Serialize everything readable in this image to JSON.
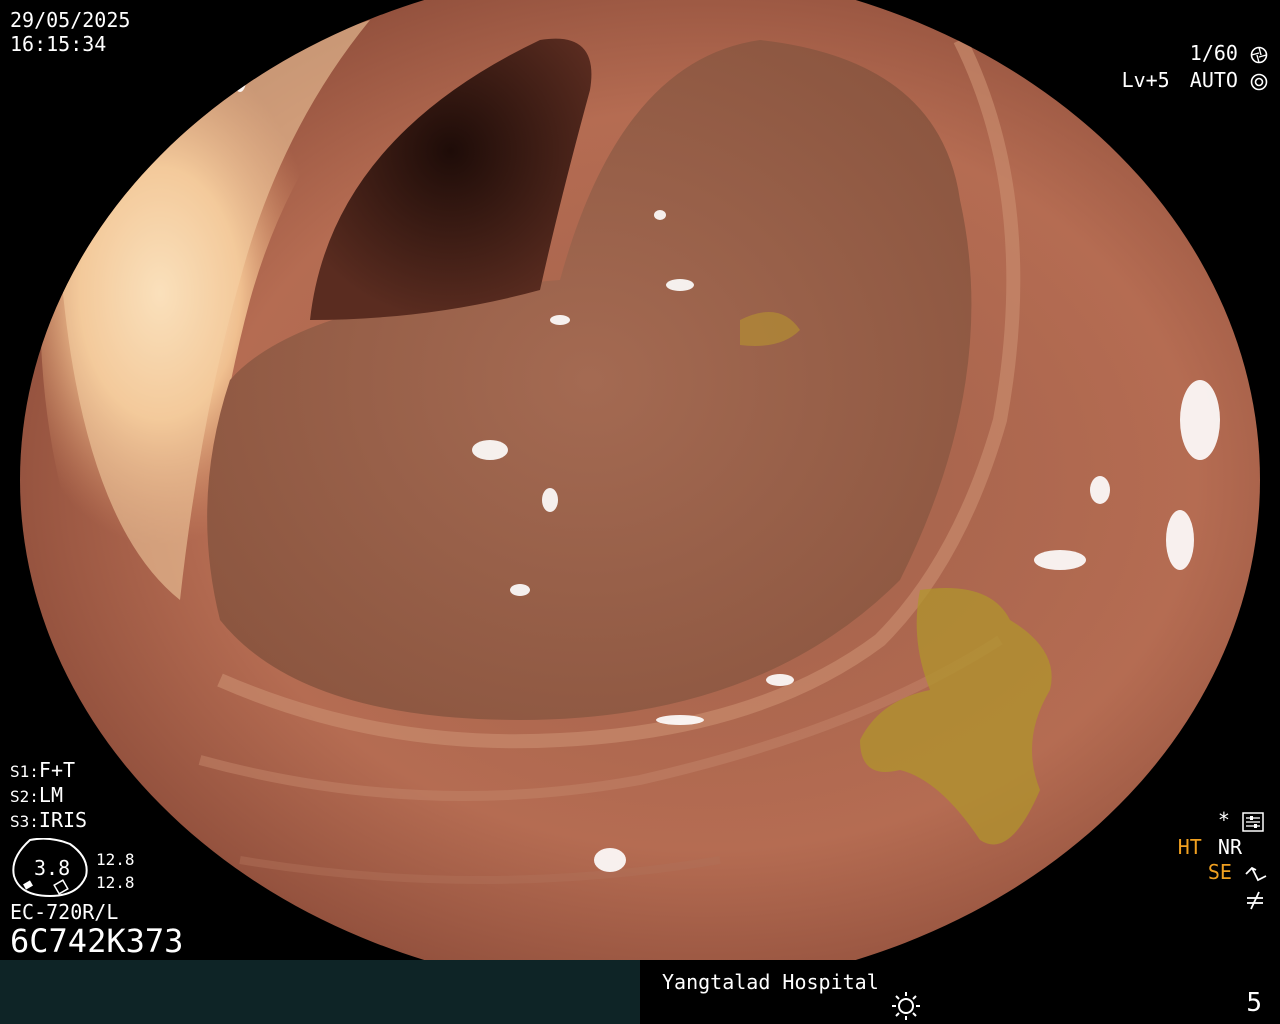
{
  "datetime": {
    "date": "29/05/2025",
    "time": "16:15:34"
  },
  "settings": {
    "shutter": "1/60",
    "shutter_icon": "aperture-icon",
    "level": "Lv+5",
    "mode": "AUTO",
    "mode_icon": "iris-icon"
  },
  "scope_presets": [
    {
      "key": "S1:",
      "value": "F+T"
    },
    {
      "key": "S2:",
      "value": "LM"
    },
    {
      "key": "S3:",
      "value": "IRIS"
    }
  ],
  "scope_gauge": {
    "value": "3.8",
    "upper": "12.8",
    "lower": "12.8"
  },
  "scope_model": "EC-720R/L",
  "scope_serial": "6C742K373",
  "right_indicators": {
    "star": "*",
    "star_icon": "settings-panel-icon",
    "ht": "HT",
    "nr": "NR",
    "se": "SE",
    "se_icon": "wave-enhance-icon",
    "freeze_icon": "not-equal-icon"
  },
  "bottom": {
    "hospital": "Yangtalad Hospital",
    "brightness_icon": "sun-icon",
    "page": "5"
  },
  "colors": {
    "accent_orange": "#f0a020",
    "bottom_panel": "#0e2426"
  }
}
